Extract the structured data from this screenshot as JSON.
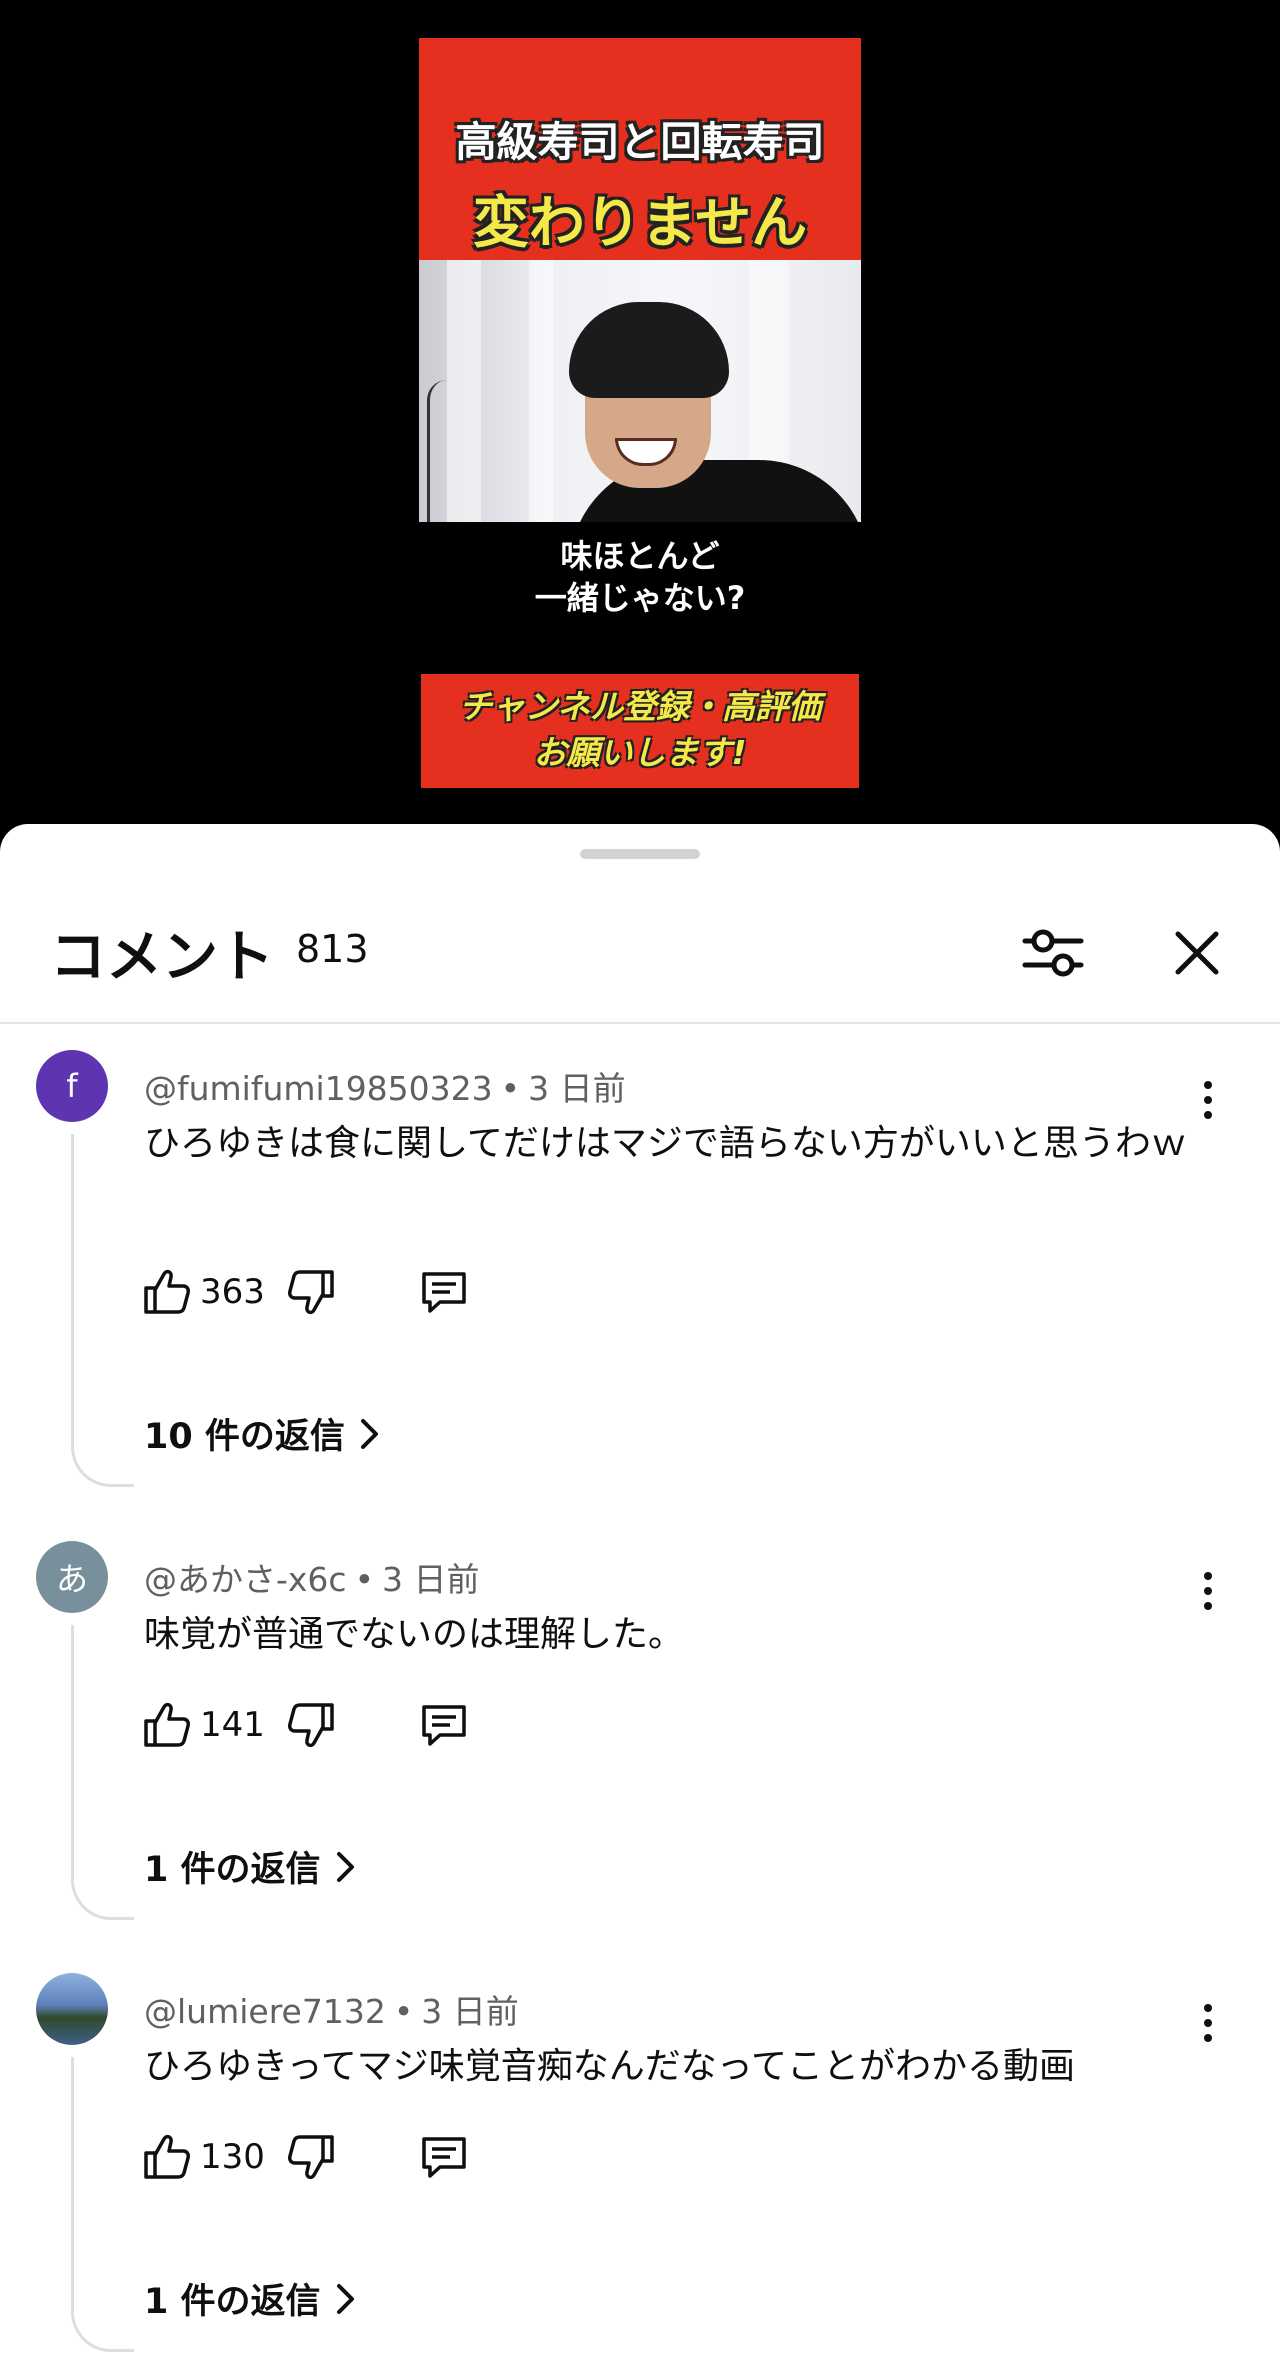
{
  "video": {
    "title_line1": "高級寿司と回転寿司",
    "title_line2": "変わりません",
    "subtitle_line1": "味ほとんど",
    "subtitle_line2": "一緒じゃない?",
    "cta_line1": "チャンネル登録・高評価",
    "cta_line2": "お願いします!"
  },
  "sheet": {
    "title": "コメント",
    "count": "813",
    "filter_icon": "filter-icon",
    "close_icon": "close-icon"
  },
  "comments": [
    {
      "avatar_letter": "f",
      "avatar_color": "#5e35b1",
      "author": "@fumifumi19850323",
      "sep": "•",
      "time": "3 日前",
      "text": "ひろゆきは食に関してだけはマジで語らない方がいいと思うわｗ",
      "likes": "363",
      "replies": "10 件の返信"
    },
    {
      "avatar_letter": "あ",
      "avatar_color": "#78909c",
      "author": "@あかさ-x6c",
      "sep": "•",
      "time": "3 日前",
      "text": "味覚が普通でないのは理解した。",
      "likes": "141",
      "replies": "1 件の返信"
    },
    {
      "avatar_letter": "",
      "avatar_color": "#6f93c4",
      "author": "@lumiere7132",
      "sep": "•",
      "time": "3 日前",
      "text": "ひろゆきってマジ味覚音痴なんだなってことがわかる動画",
      "likes": "130",
      "replies": "1 件の返信"
    }
  ]
}
